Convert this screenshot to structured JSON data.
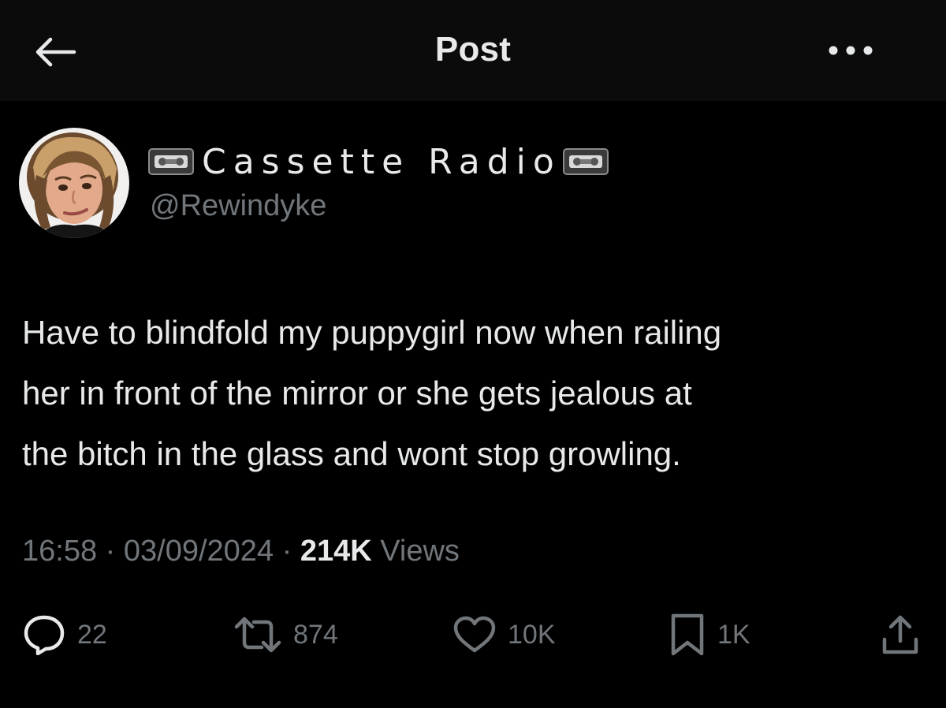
{
  "header": {
    "title": "Post",
    "back_icon": "arrow-left-icon",
    "more_icon": "more-horizontal-icon"
  },
  "author": {
    "display_name": "Cassette Radio",
    "handle": "@Rewindyke",
    "name_decoration_icon": "videocassette-emoji"
  },
  "post": {
    "lines": [
      "Have to blindfold my puppygirl now when railing",
      "her in front of the mirror or she gets jealous at",
      "the bitch in the glass and wont stop growling."
    ]
  },
  "meta": {
    "time": "16:58",
    "date": "03/09/2024",
    "separator": "·",
    "views_count": "214K",
    "views_label": "Views"
  },
  "actions": {
    "reply": {
      "icon": "reply-bubble-icon",
      "count": "22"
    },
    "repost": {
      "icon": "repost-icon",
      "count": "874"
    },
    "like": {
      "icon": "heart-icon",
      "count": "10K"
    },
    "bookmark": {
      "icon": "bookmark-icon",
      "count": "1K"
    },
    "share": {
      "icon": "share-icon"
    }
  },
  "colors": {
    "background": "#000000",
    "header_background": "#0b0b0b",
    "primary_text": "#e7e9ea",
    "secondary_text": "#71767b"
  }
}
